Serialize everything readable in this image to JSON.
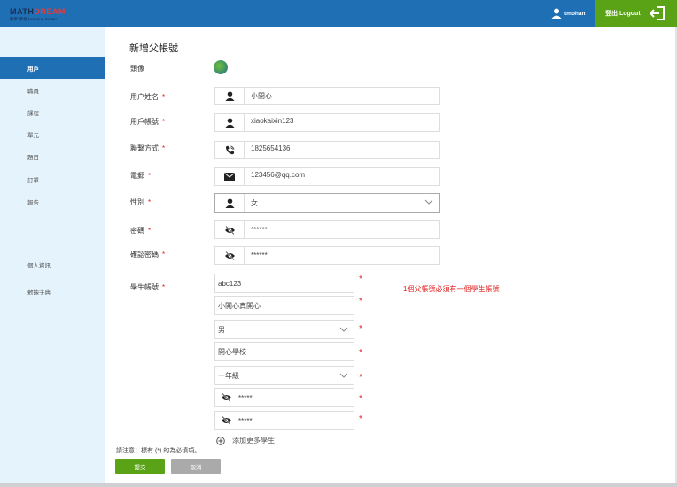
{
  "header": {
    "logo_main_a": "MATH",
    "logo_main_b": "DREAM",
    "logo_sub": "數學·夢想 Learning Center",
    "username": "tmohan",
    "logout_label": "登出 Logout",
    "bar_color": "#1f6fb5",
    "logout_color": "#5aa316"
  },
  "sidebar": {
    "items": [
      {
        "label": "用戶",
        "active": true
      },
      {
        "label": "職員"
      },
      {
        "label": "課程"
      },
      {
        "label": "單元"
      },
      {
        "label": "題目"
      },
      {
        "label": "訂單"
      },
      {
        "label": "報告"
      },
      {
        "label": "個人資訊"
      },
      {
        "label": "數據字典"
      }
    ]
  },
  "form": {
    "title": "新增父帳號",
    "avatar_label": "頭像",
    "name": {
      "label": "用户姓名",
      "value": "小開心",
      "icon": "user-icon"
    },
    "account": {
      "label": "用戶帳號",
      "value": "xiaokaixin123",
      "icon": "user-icon"
    },
    "contact": {
      "label": "聯繫方式",
      "value": "1825654136",
      "icon": "phone-icon"
    },
    "email": {
      "label": "電郵",
      "value": "123456@qq.com",
      "icon": "mail-icon"
    },
    "gender": {
      "label": "性別",
      "value": "女",
      "icon": "user-icon"
    },
    "password": {
      "label": "密碼",
      "value": "******",
      "icon": "eye-off-icon"
    },
    "confirm_password": {
      "label": "確認密碼",
      "value": "******",
      "icon": "eye-off-icon"
    },
    "student": {
      "label": "學生帳號",
      "account": "abc123",
      "name": "小開心真開心",
      "gender": "男",
      "school": "開心學校",
      "grade": "一年級",
      "password": "*****",
      "confirm_password": "*****"
    },
    "required_mark": "*",
    "notice": "1個父帳號必須有一個學生帳號",
    "add_more": "添加更多學生",
    "note": "請注意：標有 (*) 的為必填項。",
    "submit": "提交",
    "cancel": "取消",
    "error_color": "#e02020"
  }
}
